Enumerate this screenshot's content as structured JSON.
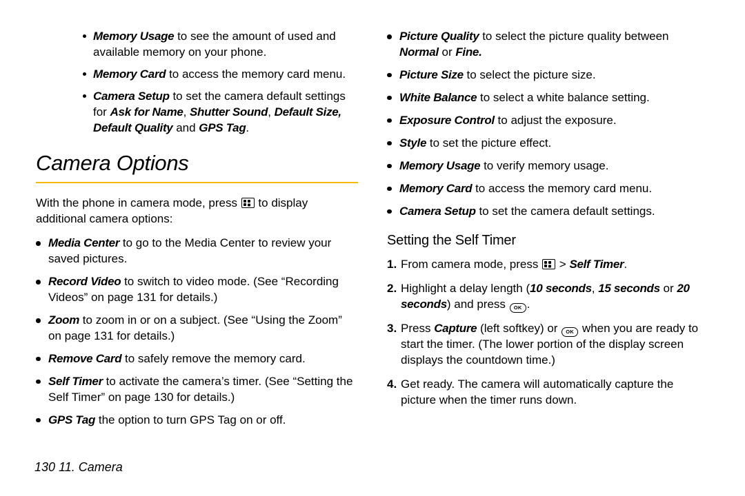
{
  "leftTop": {
    "memUsage": {
      "term": "Memory Usage",
      "text": " to see the amount of used and available memory on your phone."
    },
    "memCard": {
      "term": "Memory Card",
      "text": " to access the memory card menu."
    },
    "camSetup": {
      "term": "Camera Setup",
      "pre": " to set the camera default settings for ",
      "ask": "Ask for Name",
      "c1": ", ",
      "shutter": "Shutter Sound",
      "c2": ", ",
      "defsize": "Default Size,",
      "defqual": "Default Quality",
      "and": " and ",
      "gps": "GPS Tag",
      "end": "."
    }
  },
  "sectionTitle": "Camera Options",
  "intro": {
    "pre": "With the phone in camera mode, press ",
    "post": " to display additional camera options:"
  },
  "leftList": {
    "media": {
      "term": "Media Center",
      "text": " to go to the Media Center to review your saved pictures."
    },
    "record": {
      "term": "Record Video",
      "text": " to switch to video mode. (See “Recording Videos” on page 131 for details.)"
    },
    "zoom": {
      "term": "Zoom",
      "text": " to zoom in or on a subject. (See “Using the Zoom” on page 131 for details.)"
    },
    "remove": {
      "term": "Remove Card",
      "text": " to safely remove the memory card."
    },
    "self": {
      "term": "Self Timer",
      "text": " to activate the camera’s timer. (See “Setting the Self Timer” on page 130 for details.)"
    },
    "gps": {
      "term": " GPS Tag",
      "text": " the option to turn GPS Tag on or off."
    }
  },
  "rightTop": {
    "pq": {
      "term": "Picture Quality",
      "pre": " to select the picture quality between ",
      "n": "Normal",
      "or": " or ",
      "f": "Fine."
    },
    "ps": {
      "term": "Picture Size",
      "text": " to select the picture size."
    },
    "wb": {
      "term": "White Balance",
      "text": " to select a white balance setting."
    },
    "ex": {
      "term": "Exposure Control",
      "text": " to adjust the exposure."
    },
    "st": {
      "term": "Style",
      "text": " to set the picture effect."
    },
    "mu": {
      "term": "Memory Usage",
      "text": " to verify memory usage."
    },
    "mc": {
      "term": "Memory Card",
      "text": " to access the memory card menu."
    },
    "cs": {
      "term": "Camera Setup",
      "text": " to set the camera default settings."
    }
  },
  "subHeading": "Setting the Self Timer",
  "steps": {
    "s1": {
      "pre": "From camera mode, press ",
      "gt": " > ",
      "st": "Self Timer",
      "end": "."
    },
    "s2": {
      "pre": "Highlight a delay length (",
      "t1": "10 seconds",
      "c1": ", ",
      "t2": "15 seconds",
      "or": " or ",
      "t3": "20 seconds",
      "post": ") and press ",
      "end": "."
    },
    "s3": {
      "pre": "Press ",
      "cap": "Capture",
      "mid1": " (left softkey) or ",
      "mid2": " when you are ready to start the timer. (The lower portion of the display screen displays the countdown time.)"
    },
    "s4": "Get ready. The camera will automatically capture the picture when the timer runs down."
  },
  "footer": {
    "page": "130",
    "sep": "    ",
    "chap": "11. Camera"
  },
  "ok": "OK"
}
